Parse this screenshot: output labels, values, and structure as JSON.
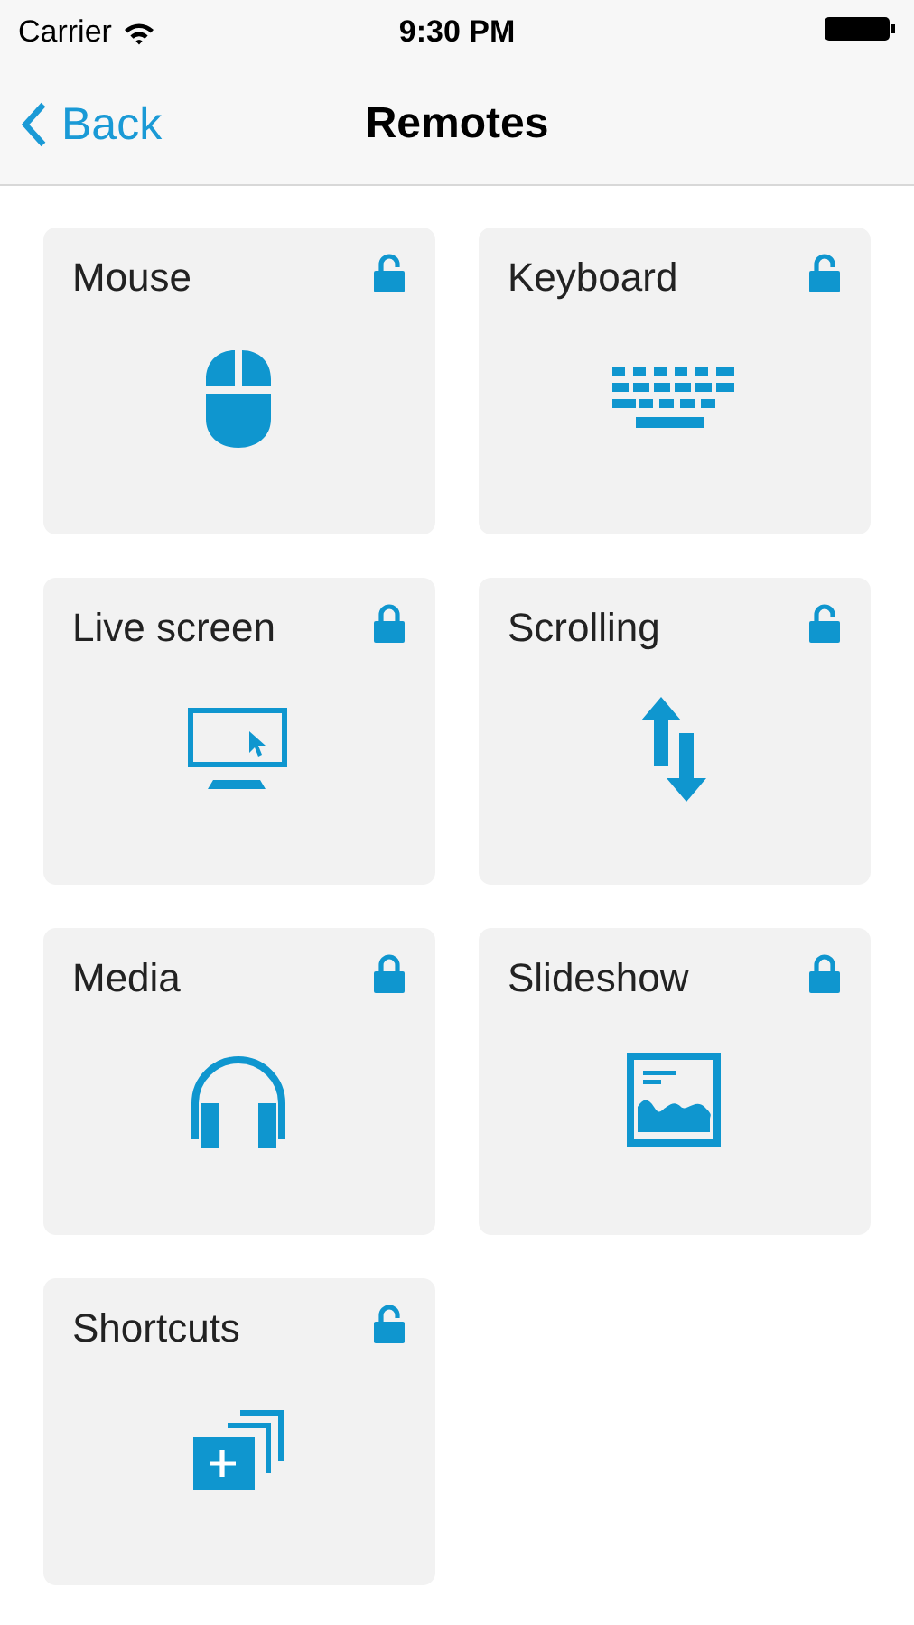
{
  "status_bar": {
    "carrier": "Carrier",
    "time": "9:30 PM"
  },
  "nav": {
    "back": "Back",
    "title": "Remotes"
  },
  "tiles": [
    {
      "label": "Mouse",
      "kind": "mouse",
      "locked": false
    },
    {
      "label": "Keyboard",
      "kind": "keyboard",
      "locked": false
    },
    {
      "label": "Live screen",
      "kind": "screen",
      "locked": true
    },
    {
      "label": "Scrolling",
      "kind": "scrolling",
      "locked": false
    },
    {
      "label": "Media",
      "kind": "media",
      "locked": true
    },
    {
      "label": "Slideshow",
      "kind": "slideshow",
      "locked": true
    },
    {
      "label": "Shortcuts",
      "kind": "shortcuts",
      "locked": false
    }
  ]
}
